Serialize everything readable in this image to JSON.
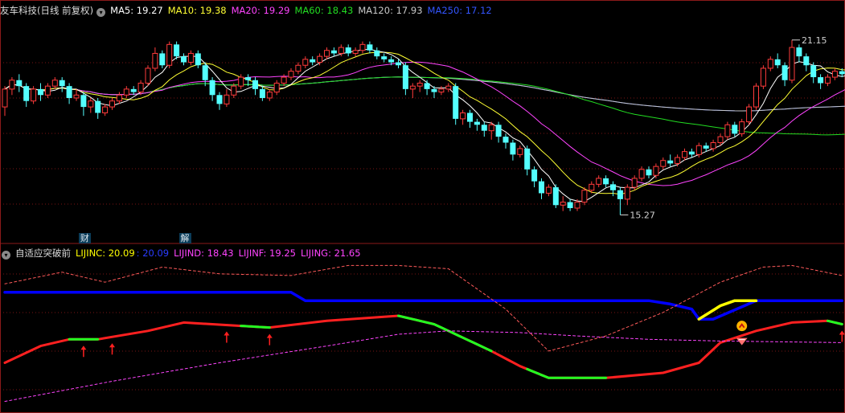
{
  "colors": {
    "bg": "#000000",
    "grid": "#7a1414",
    "up": "#ff3b3b",
    "down": "#54ffff",
    "ma5": "#ffffff",
    "ma10": "#ffff33",
    "ma20": "#ff44ff",
    "ma60": "#22dd22",
    "ma120": "#c8c8c8",
    "ma250": "#3355ff",
    "lijinc": "#ffff00",
    "lijine": "#0000ff",
    "lijind": "#ff2020",
    "lijinf": "#ff44ff",
    "lijing": "#ff5a5a",
    "green_seg": "#22ff22",
    "arrow": "#ff2020"
  },
  "top_header": {
    "title": "友车科技(日线 前复权)",
    "toggle_glyph": "▾",
    "ma5": "MA5: 19.27",
    "ma10": "MA10: 19.38",
    "ma20": "MA20: 19.29",
    "ma60": "MA60: 18.43",
    "ma120": "MA120: 17.93",
    "ma250": "MA250: 17.12"
  },
  "bottom_header": {
    "title": "自适应突破前",
    "toggle_glyph": "▾",
    "lijinc": "LIJINC: 20.09",
    "lijine": ": 20.09",
    "lijind": "LIJIND: 18.43",
    "lijinf": "LIJINF: 19.25",
    "lijing": "LIJING: 21.65"
  },
  "tags": [
    {
      "text": "财",
      "index": 11
    },
    {
      "text": "解",
      "index": 25
    }
  ],
  "chart_data": [
    {
      "type": "candlestick",
      "title": "友车科技(日线 前复权)",
      "y_range": [
        14.5,
        21.9
      ],
      "annotations": [
        {
          "text": "21.15",
          "index": 110,
          "value": 21.15,
          "kind": "high"
        },
        {
          "text": "15.27",
          "index": 86,
          "value": 15.27,
          "kind": "low"
        }
      ],
      "candles": [
        [
          18.9,
          19.5,
          19.6,
          18.6
        ],
        [
          19.5,
          19.8,
          19.9,
          19.3
        ],
        [
          19.8,
          19.6,
          20.0,
          19.4
        ],
        [
          19.6,
          19.1,
          19.7,
          18.9
        ],
        [
          19.1,
          19.5,
          19.6,
          19.0
        ],
        [
          19.5,
          19.3,
          19.7,
          19.1
        ],
        [
          19.3,
          19.6,
          19.7,
          19.2
        ],
        [
          19.6,
          19.8,
          19.9,
          19.5
        ],
        [
          19.8,
          19.6,
          19.9,
          19.4
        ],
        [
          19.6,
          19.2,
          19.7,
          19.0
        ],
        [
          19.2,
          19.3,
          19.5,
          19.1
        ],
        [
          19.3,
          18.9,
          19.4,
          18.6
        ],
        [
          18.9,
          19.1,
          19.2,
          18.7
        ],
        [
          19.1,
          18.7,
          19.2,
          18.5
        ],
        [
          18.7,
          18.9,
          19.0,
          18.6
        ],
        [
          18.9,
          19.1,
          19.2,
          18.8
        ],
        [
          19.1,
          19.3,
          19.4,
          19.0
        ],
        [
          19.3,
          19.5,
          19.6,
          19.2
        ],
        [
          19.5,
          19.4,
          19.6,
          19.3
        ],
        [
          19.4,
          19.7,
          19.8,
          19.3
        ],
        [
          19.7,
          20.2,
          20.3,
          19.6
        ],
        [
          20.2,
          20.7,
          20.9,
          20.1
        ],
        [
          20.7,
          20.3,
          20.8,
          20.2
        ],
        [
          20.3,
          21.0,
          21.1,
          20.2
        ],
        [
          21.0,
          20.6,
          21.1,
          20.5
        ],
        [
          20.6,
          20.4,
          20.7,
          20.3
        ],
        [
          20.4,
          20.7,
          20.8,
          20.3
        ],
        [
          20.7,
          20.3,
          20.8,
          20.2
        ],
        [
          20.3,
          19.8,
          20.4,
          19.6
        ],
        [
          19.8,
          19.3,
          19.9,
          19.1
        ],
        [
          19.3,
          19.0,
          19.4,
          18.8
        ],
        [
          19.0,
          19.3,
          19.5,
          18.9
        ],
        [
          19.3,
          19.6,
          19.7,
          19.2
        ],
        [
          19.6,
          19.9,
          20.0,
          19.5
        ],
        [
          19.9,
          19.8,
          20.0,
          19.6
        ],
        [
          19.8,
          19.5,
          19.9,
          19.3
        ],
        [
          19.5,
          19.2,
          19.6,
          19.1
        ],
        [
          19.2,
          19.4,
          19.5,
          19.1
        ],
        [
          19.4,
          19.7,
          19.8,
          19.3
        ],
        [
          19.7,
          19.9,
          20.0,
          19.6
        ],
        [
          19.9,
          20.1,
          20.2,
          19.8
        ],
        [
          20.1,
          20.3,
          20.4,
          20.0
        ],
        [
          20.3,
          20.5,
          20.6,
          20.2
        ],
        [
          20.5,
          20.4,
          20.6,
          20.3
        ],
        [
          20.4,
          20.6,
          20.7,
          20.3
        ],
        [
          20.6,
          20.8,
          20.9,
          20.5
        ],
        [
          20.8,
          20.7,
          20.9,
          20.6
        ],
        [
          20.7,
          20.9,
          21.0,
          20.6
        ],
        [
          20.9,
          20.7,
          21.0,
          20.6
        ],
        [
          20.7,
          20.8,
          20.9,
          20.6
        ],
        [
          20.8,
          21.0,
          21.1,
          20.7
        ],
        [
          21.0,
          20.8,
          21.1,
          20.7
        ],
        [
          20.8,
          20.6,
          20.9,
          20.5
        ],
        [
          20.6,
          20.5,
          20.7,
          20.4
        ],
        [
          20.5,
          20.4,
          20.6,
          20.3
        ],
        [
          20.4,
          20.3,
          20.5,
          20.2
        ],
        [
          20.3,
          19.5,
          20.4,
          19.3
        ],
        [
          19.5,
          19.6,
          19.7,
          19.2
        ],
        [
          19.6,
          19.7,
          19.8,
          19.4
        ],
        [
          19.7,
          19.5,
          19.8,
          19.3
        ],
        [
          19.5,
          19.4,
          19.6,
          19.2
        ],
        [
          19.4,
          19.5,
          19.6,
          19.3
        ],
        [
          19.5,
          19.6,
          19.7,
          19.4
        ],
        [
          19.6,
          18.5,
          19.7,
          18.3
        ],
        [
          18.5,
          18.7,
          18.8,
          18.3
        ],
        [
          18.7,
          18.4,
          18.8,
          18.2
        ],
        [
          18.4,
          18.3,
          18.5,
          18.1
        ],
        [
          18.3,
          18.1,
          18.4,
          17.9
        ],
        [
          18.1,
          18.3,
          18.4,
          17.8
        ],
        [
          18.3,
          17.9,
          18.4,
          17.7
        ],
        [
          17.9,
          17.7,
          18.0,
          17.5
        ],
        [
          17.7,
          17.3,
          17.8,
          17.1
        ],
        [
          17.3,
          17.5,
          17.6,
          17.2
        ],
        [
          17.5,
          16.8,
          17.6,
          16.6
        ],
        [
          16.8,
          16.4,
          16.9,
          16.2
        ],
        [
          16.4,
          16.0,
          16.5,
          15.8
        ],
        [
          16.0,
          16.2,
          16.3,
          15.9
        ],
        [
          16.2,
          15.6,
          16.3,
          15.5
        ],
        [
          15.6,
          15.7,
          15.9,
          15.4
        ],
        [
          15.7,
          15.5,
          15.8,
          15.4
        ],
        [
          15.5,
          15.7,
          15.8,
          15.4
        ],
        [
          15.7,
          16.1,
          16.2,
          15.6
        ],
        [
          16.1,
          16.3,
          16.4,
          16.0
        ],
        [
          16.3,
          16.5,
          16.6,
          16.2
        ],
        [
          16.5,
          16.3,
          16.6,
          16.2
        ],
        [
          16.3,
          16.1,
          16.4,
          15.9
        ],
        [
          16.1,
          15.8,
          16.2,
          15.27
        ],
        [
          15.8,
          16.2,
          16.3,
          15.6
        ],
        [
          16.2,
          16.5,
          16.6,
          16.1
        ],
        [
          16.5,
          16.8,
          16.9,
          16.4
        ],
        [
          16.8,
          16.6,
          16.9,
          16.5
        ],
        [
          16.6,
          16.9,
          17.0,
          16.5
        ],
        [
          16.9,
          17.1,
          17.2,
          16.8
        ],
        [
          17.1,
          17.0,
          17.3,
          16.9
        ],
        [
          17.0,
          17.2,
          17.3,
          16.9
        ],
        [
          17.2,
          17.4,
          17.5,
          17.1
        ],
        [
          17.4,
          17.3,
          17.5,
          17.2
        ],
        [
          17.3,
          17.6,
          17.7,
          17.2
        ],
        [
          17.6,
          17.5,
          17.7,
          17.4
        ],
        [
          17.5,
          17.7,
          17.8,
          17.4
        ],
        [
          17.7,
          17.9,
          18.0,
          17.6
        ],
        [
          17.9,
          18.3,
          18.4,
          17.8
        ],
        [
          18.3,
          18.0,
          18.4,
          17.9
        ],
        [
          18.0,
          18.4,
          18.5,
          17.9
        ],
        [
          18.4,
          18.9,
          19.0,
          18.3
        ],
        [
          18.9,
          19.6,
          19.7,
          18.8
        ],
        [
          19.6,
          20.2,
          20.3,
          19.5
        ],
        [
          20.2,
          20.5,
          20.6,
          20.1
        ],
        [
          20.5,
          20.3,
          20.7,
          20.2
        ],
        [
          20.3,
          19.8,
          20.4,
          19.6
        ],
        [
          19.8,
          20.9,
          21.15,
          19.7
        ],
        [
          20.9,
          20.6,
          21.0,
          20.4
        ],
        [
          20.6,
          20.3,
          20.7,
          20.1
        ],
        [
          20.3,
          19.9,
          20.4,
          19.7
        ],
        [
          19.9,
          19.7,
          20.0,
          19.5
        ],
        [
          19.7,
          19.9,
          20.0,
          19.6
        ],
        [
          19.9,
          20.1,
          20.2,
          19.8
        ],
        [
          20.1,
          20.0,
          20.2,
          19.9
        ],
        [
          20.0,
          20.2,
          20.3,
          19.9
        ],
        [
          20.2,
          20.4,
          20.5,
          20.1
        ],
        [
          20.4,
          20.2,
          20.5,
          20.1
        ],
        [
          20.2,
          20.0,
          20.3,
          19.9
        ],
        [
          20.0,
          19.6,
          20.1,
          19.5
        ],
        [
          19.6,
          19.4,
          19.7,
          19.3
        ],
        [
          19.4,
          19.6,
          19.7,
          19.3
        ]
      ]
    },
    {
      "type": "line",
      "title": "自适应突破前",
      "y_range": [
        10,
        100
      ],
      "series": [
        {
          "name": "LIJINE",
          "key": "lijine",
          "width": 3.5,
          "points": [
            [
              0,
              80
            ],
            [
              40,
              80
            ],
            [
              42,
              75
            ],
            [
              90,
              75
            ],
            [
              93,
              73
            ],
            [
              96,
              70
            ],
            [
              97,
              64
            ],
            [
              99,
              64
            ],
            [
              105,
              75
            ],
            [
              117,
              75
            ]
          ]
        },
        {
          "name": "LIJINC",
          "key": "lijinc",
          "width": 3.5,
          "points": [
            [
              97,
              64
            ],
            [
              100,
              72
            ],
            [
              102,
              75
            ],
            [
              105,
              75
            ]
          ]
        },
        {
          "name": "LIJIND",
          "key": "lijind",
          "width": 3,
          "highlight_ranges": [
            [
              9,
              13
            ],
            [
              33,
              37
            ],
            [
              55,
              68
            ],
            [
              73,
              84
            ],
            [
              115,
              117
            ]
          ],
          "points": [
            [
              0,
              38
            ],
            [
              5,
              48
            ],
            [
              9,
              52
            ],
            [
              13,
              52
            ],
            [
              20,
              57
            ],
            [
              25,
              62
            ],
            [
              33,
              60
            ],
            [
              37,
              59
            ],
            [
              45,
              63
            ],
            [
              55,
              66
            ],
            [
              60,
              61
            ],
            [
              68,
              45
            ],
            [
              72,
              36
            ],
            [
              76,
              29
            ],
            [
              84,
              29
            ],
            [
              92,
              32
            ],
            [
              97,
              38
            ],
            [
              100,
              50
            ],
            [
              105,
              57
            ],
            [
              110,
              62
            ],
            [
              115,
              63
            ],
            [
              117,
              61
            ]
          ]
        },
        {
          "name": "LIJINF",
          "key": "lijinf",
          "width": 1,
          "dashed": true,
          "points": [
            [
              0,
              15
            ],
            [
              15,
              27
            ],
            [
              30,
              38
            ],
            [
              45,
              48
            ],
            [
              55,
              55
            ],
            [
              62,
              57
            ],
            [
              72,
              56
            ],
            [
              80,
              54
            ],
            [
              90,
              52
            ],
            [
              100,
              51
            ],
            [
              117,
              50
            ]
          ]
        },
        {
          "name": "LIJING",
          "key": "lijing",
          "width": 1,
          "dashed": true,
          "points": [
            [
              0,
              85
            ],
            [
              8,
              92
            ],
            [
              14,
              86
            ],
            [
              22,
              95
            ],
            [
              30,
              91
            ],
            [
              40,
              90
            ],
            [
              48,
              96
            ],
            [
              55,
              96
            ],
            [
              62,
              94
            ],
            [
              70,
              70
            ],
            [
              76,
              45
            ],
            [
              84,
              54
            ],
            [
              92,
              68
            ],
            [
              100,
              86
            ],
            [
              106,
              95
            ],
            [
              110,
              96
            ],
            [
              117,
              90
            ]
          ]
        }
      ],
      "arrows": [
        11,
        15,
        31,
        37,
        117
      ],
      "markers": [
        {
          "index": 103,
          "kind": "up-badge"
        },
        {
          "index": 103,
          "kind": "down-badge"
        }
      ]
    }
  ]
}
